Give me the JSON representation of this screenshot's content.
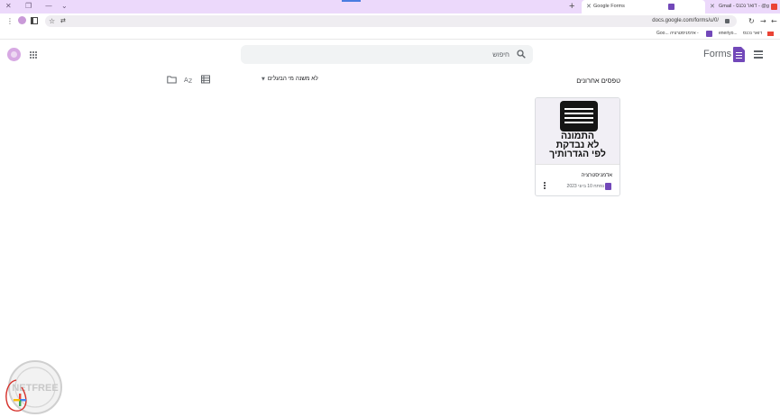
{
  "browser": {
    "tabs": [
      {
        "title": "Gmail - דואר נכנס - @gmail.com",
        "favicon": "gmail-icon",
        "active": false
      },
      {
        "title": "Google Forms",
        "favicon": "forms-icon",
        "active": true
      }
    ],
    "new_tab_label": "+",
    "url": "docs.google.com/forms/u/0/",
    "bookmarks": [
      {
        "label": "דואר נכנס",
        "icon": "gmail-icon"
      },
      {
        "label": "eneriyo...",
        "icon": "bookmark-icon"
      },
      {
        "label": "אדמניסטרציה -",
        "icon": "forms-icon"
      },
      {
        "label": "Goo...",
        "icon": "bookmark-icon"
      }
    ]
  },
  "app": {
    "title": "Forms",
    "search_placeholder": "חיפוש",
    "accent_color": "#7248b9"
  },
  "recent": {
    "section_title": "טפסים אחרונים",
    "owner_filter": "לא משנה מי הבעלים",
    "forms": [
      {
        "thumbnail_caption": [
          "התמונה",
          "לא נבדקת",
          "לפי הגדרותיך"
        ],
        "title": "אדמניסטרציה",
        "meta": "נפתח 10 ביוני 2023"
      }
    ]
  },
  "watermark": {
    "line1": "NETFREE"
  }
}
